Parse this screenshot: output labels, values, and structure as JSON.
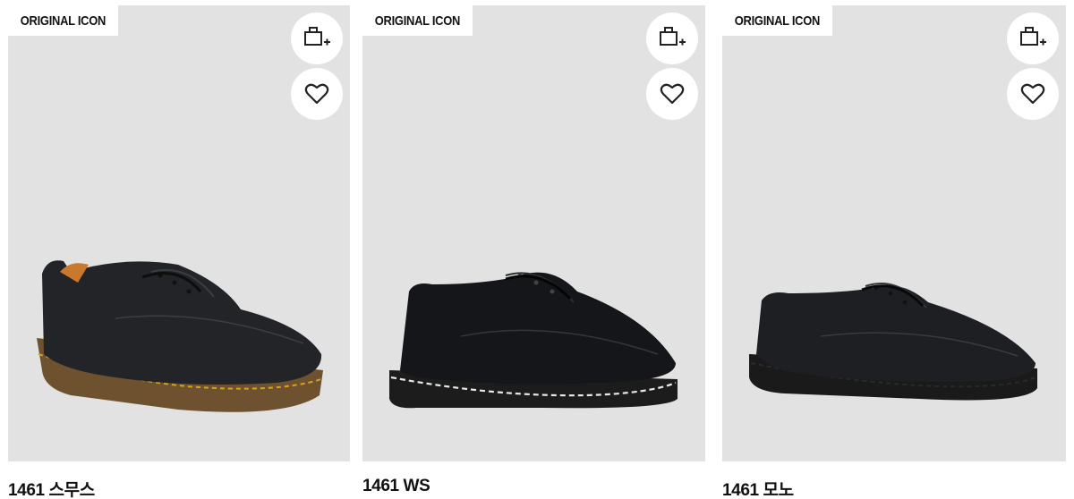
{
  "products": [
    {
      "badge": "ORIGINAL ICON",
      "name": "1461 스무스",
      "bag_icon": "bag-add-icon",
      "wish_icon": "heart-icon",
      "stitch_color": "#d9a21b",
      "sole_color": "#7b5a2e"
    },
    {
      "badge": "ORIGINAL ICON",
      "name": "1461 WS",
      "bag_icon": "bag-add-icon",
      "wish_icon": "heart-icon",
      "stitch_color": "#e8e8e8",
      "sole_color": "#1c1c1c"
    },
    {
      "badge": "ORIGINAL ICON",
      "name": "1461 모노",
      "bag_icon": "bag-add-icon",
      "wish_icon": "heart-icon",
      "stitch_color": "#2a2a2a",
      "sole_color": "#1a1a1a"
    }
  ]
}
